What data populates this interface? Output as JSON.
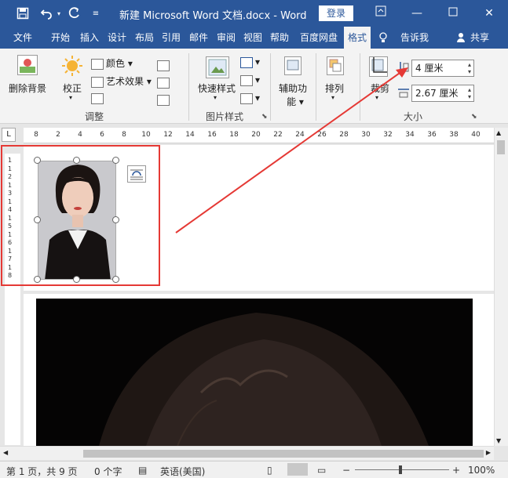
{
  "titlebar": {
    "title": "新建 Microsoft Word 文档.docx  -  Word",
    "login_label": "登录",
    "qa_icons": [
      "save-icon",
      "undo-icon",
      "redo-icon",
      "customize-icon"
    ],
    "window_icons": [
      "ribbon-display-icon",
      "minimize-icon",
      "maximize-icon",
      "close-icon"
    ]
  },
  "tabs": [
    "文件",
    "开始",
    "插入",
    "设计",
    "布局",
    "引用",
    "邮件",
    "审阅",
    "视图",
    "帮助",
    "百度网盘",
    "格式",
    "告诉我",
    "共享"
  ],
  "ribbon": {
    "remove_bg": [
      "删除",
      "背景"
    ],
    "correct": "校正",
    "color": "颜色",
    "art_effects": "艺术效果",
    "group_adjust": "调整",
    "quick_styles": "快速样式",
    "group_picture_styles": "图片样式",
    "accessibility": [
      "辅助功",
      "能"
    ],
    "arrange": "排列",
    "crop": "裁剪",
    "height_value": "4 厘米",
    "width_value": "2.67 厘米",
    "group_size": "大小"
  },
  "ruler": {
    "top_ticks": [
      "8",
      "2",
      "4",
      "6",
      "8",
      "10",
      "12",
      "14",
      "16",
      "18",
      "20",
      "22",
      "24",
      "26",
      "28",
      "30",
      "32",
      "34",
      "36",
      "38",
      "40"
    ],
    "left_ticks": [
      "1",
      "1",
      "2",
      "1",
      "3",
      "1",
      "4",
      "1",
      "5",
      "1",
      "6",
      "1",
      "7",
      "1",
      "8"
    ]
  },
  "status": {
    "page": "第 1 页，共 9 页",
    "words": "0 个字",
    "language": "英语(美国)",
    "zoom": "100%"
  },
  "colors": {
    "word_blue": "#2b579a",
    "annotation_red": "#e53935"
  }
}
